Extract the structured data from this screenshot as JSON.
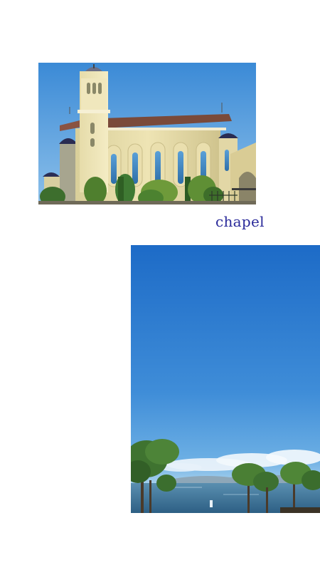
{
  "caption": {
    "text": "chapel",
    "color": "#2a2a9a"
  },
  "photos": [
    {
      "subject": "chapel"
    },
    {
      "subject": "sky-over-lake"
    }
  ]
}
